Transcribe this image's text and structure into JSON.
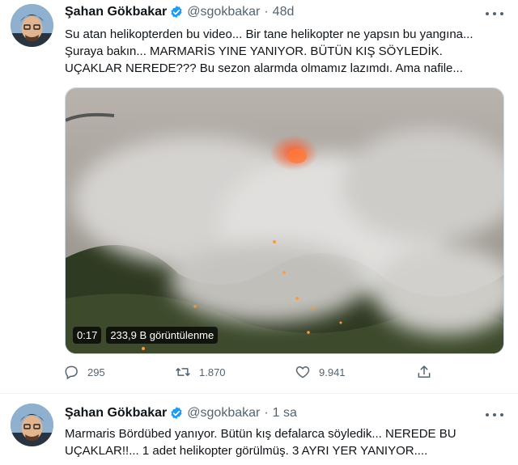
{
  "tweets": [
    {
      "name": "Şahan Gökbakar",
      "handle": "@sgokbakar",
      "separator": "·",
      "time": "48d",
      "text_lines": [
        "Su atan helikopterden bu video... Bir tane helikopter ne yapsın bu yangına...",
        "Şuraya bakın... MARMARİS YINE YANIYOR. BÜTÜN KIŞ SÖYLEDİK.",
        "UÇAKLAR NEREDE??? Bu sezon alarmda olmamız lazımdı. Ama nafile..."
      ],
      "video": {
        "duration": "0:17",
        "views": "233,9 B görüntülenme"
      },
      "actions": {
        "replies": "295",
        "retweets": "1.870",
        "likes": "9.941"
      }
    },
    {
      "name": "Şahan Gökbakar",
      "handle": "@sgokbakar",
      "separator": "·",
      "time": "1 sa",
      "text_lines": [
        "Marmaris Bördübed yanıyor. Bütün kış defalarca söyledik... NEREDE BU",
        "UÇAKLAR!!... 1 adet helikopter görülmüş. 3 AYRI YER YANIYOR...."
      ]
    }
  ],
  "colors": {
    "verified": "#1d9bf0",
    "muted": "#536471",
    "text": "#0f1419"
  }
}
